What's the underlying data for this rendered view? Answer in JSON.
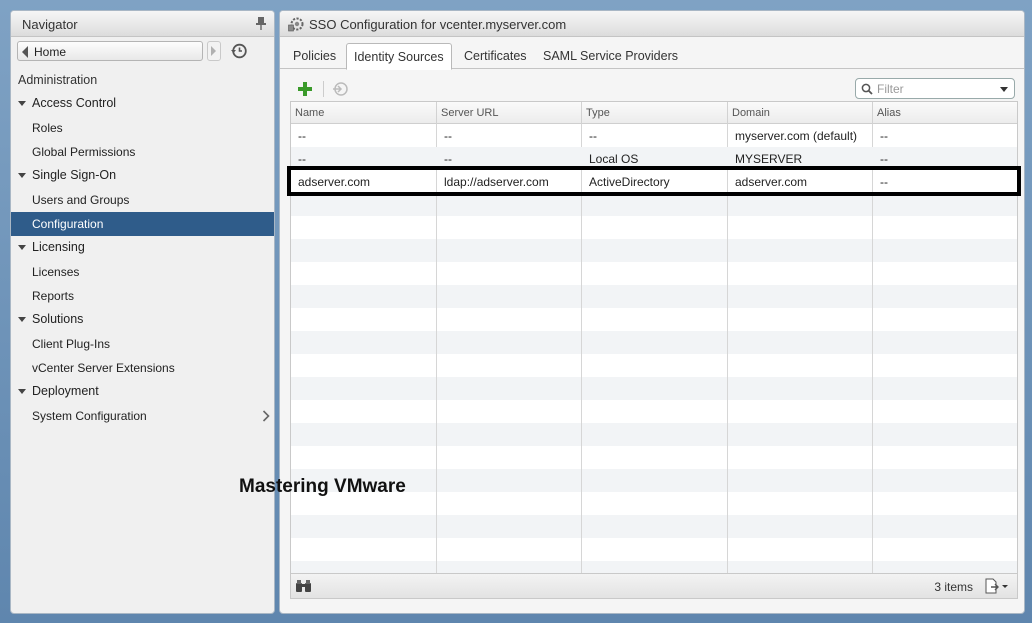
{
  "navigator": {
    "title": "Navigator",
    "home_label": "Home",
    "section": "Administration",
    "groups": [
      {
        "label": "Access Control",
        "items": [
          "Roles",
          "Global Permissions"
        ]
      },
      {
        "label": "Single Sign-On",
        "items": [
          "Users and Groups",
          "Configuration"
        ]
      },
      {
        "label": "Licensing",
        "items": [
          "Licenses",
          "Reports"
        ]
      },
      {
        "label": "Solutions",
        "items": [
          "Client Plug-Ins",
          "vCenter Server Extensions"
        ]
      },
      {
        "label": "Deployment",
        "items": [
          "System Configuration"
        ]
      }
    ],
    "selected_item": "Configuration"
  },
  "main": {
    "title": "SSO Configuration for vcenter.myserver.com",
    "tabs": [
      "Policies",
      "Identity Sources",
      "Certificates",
      "SAML Service Providers"
    ],
    "active_tab": "Identity Sources",
    "filter_placeholder": "Filter",
    "table": {
      "columns": [
        "Name",
        "Server URL",
        "Type",
        "Domain",
        "Alias"
      ],
      "rows": [
        [
          "--",
          "--",
          "--",
          "myserver.com (default)",
          "--"
        ],
        [
          "--",
          "--",
          "Local OS",
          "MYSERVER",
          "--"
        ],
        [
          "adserver.com",
          "ldap://adserver.com",
          "ActiveDirectory",
          "adserver.com",
          "--"
        ]
      ]
    },
    "items_count": "3 items"
  },
  "watermark": "Mastering VMware",
  "icons": {
    "pin": "pin-icon",
    "history": "history-icon",
    "config": "sso-config-icon",
    "add": "add-icon",
    "edit": "edit-icon",
    "search": "search-icon",
    "find": "binoculars-icon",
    "export": "export-icon"
  },
  "colors": {
    "selection": "#2f5c8a",
    "add_icon": "#3a9a2a",
    "background": "#6b8fb5"
  }
}
